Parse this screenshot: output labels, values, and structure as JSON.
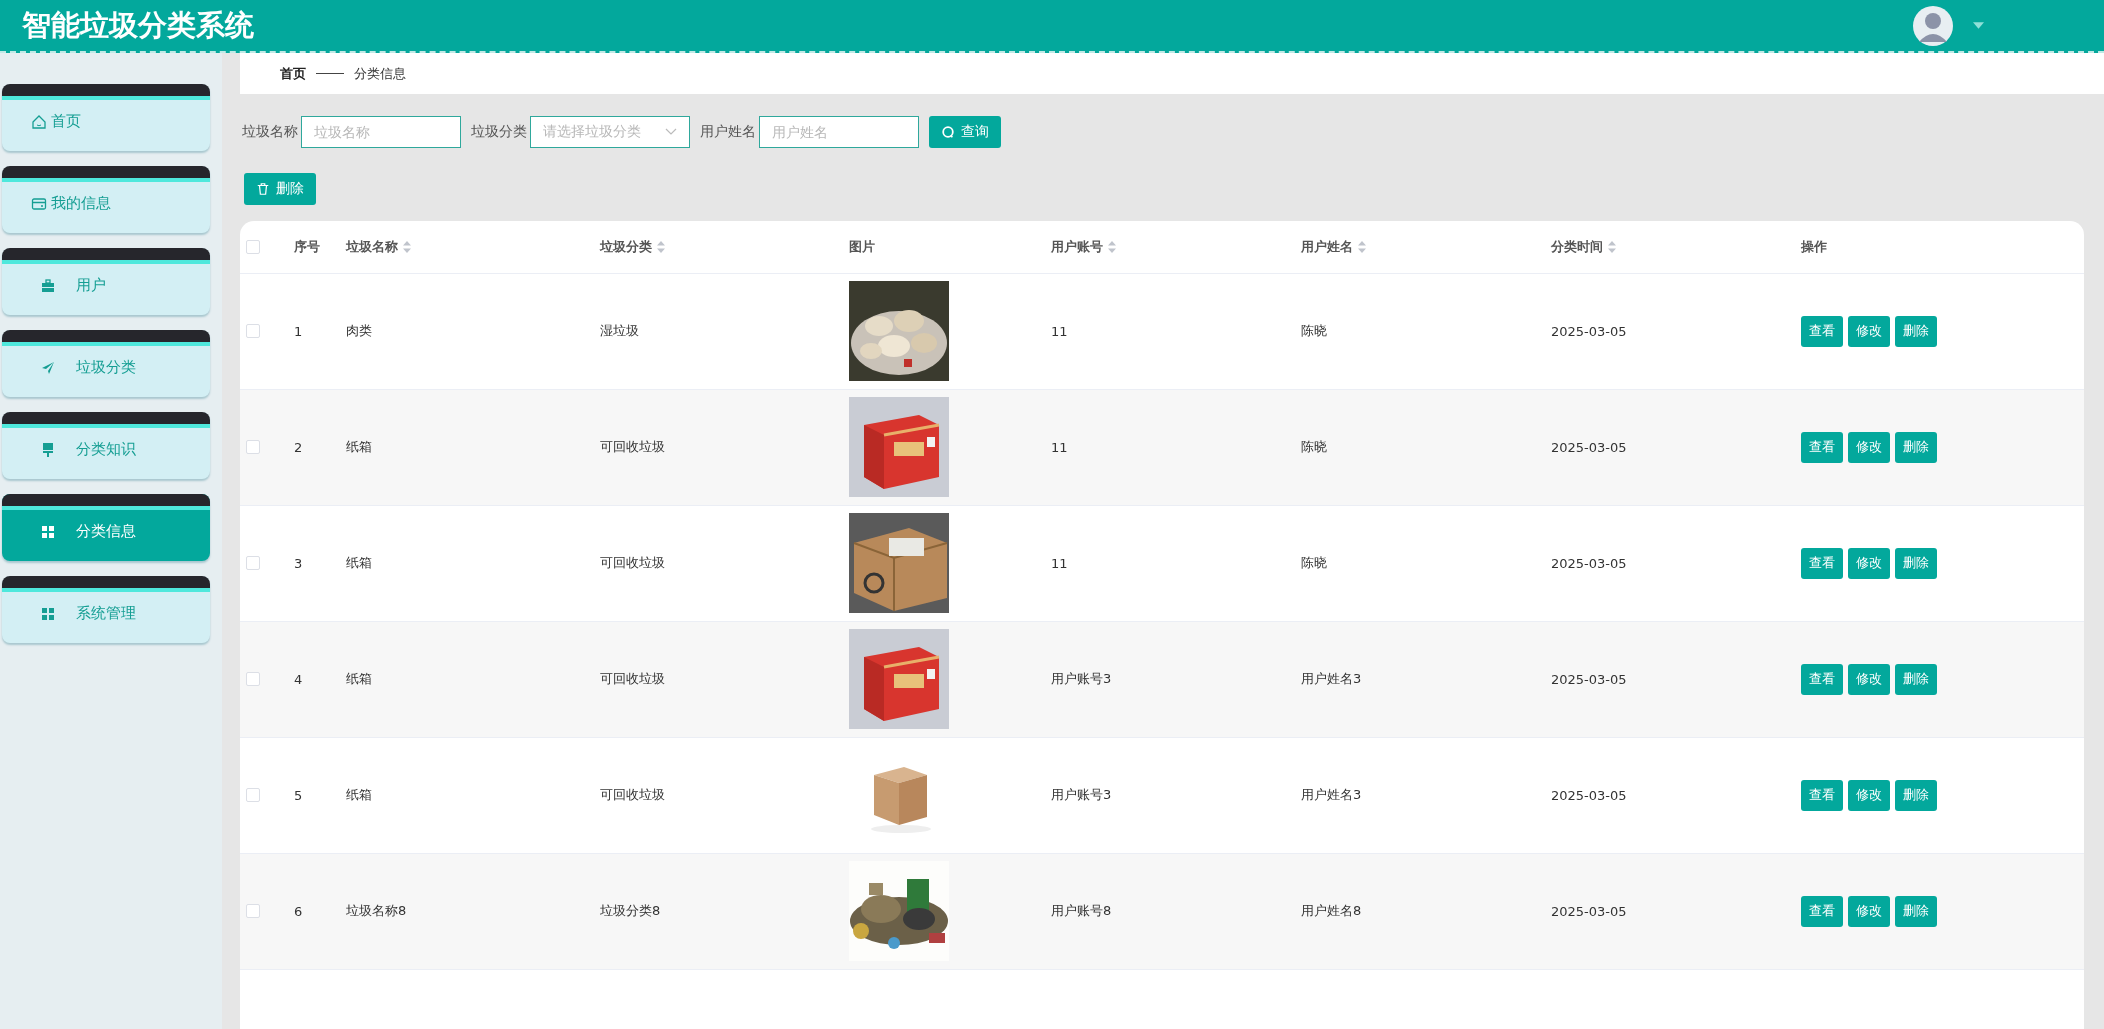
{
  "header": {
    "title": "智能垃圾分类系统"
  },
  "sidebar": {
    "items": [
      {
        "label": "首页",
        "selected": false
      },
      {
        "label": "我的信息",
        "selected": false
      },
      {
        "label": "用户",
        "selected": false
      },
      {
        "label": "垃圾分类",
        "selected": false
      },
      {
        "label": "分类知识",
        "selected": false
      },
      {
        "label": "分类信息",
        "selected": true
      },
      {
        "label": "系统管理",
        "selected": false
      }
    ]
  },
  "breadcrumb": [
    "首页",
    "分类信息"
  ],
  "search": {
    "fields": [
      {
        "label": "垃圾名称",
        "placeholder": "垃圾名称",
        "kind": "text"
      },
      {
        "label": "垃圾分类",
        "placeholder": "请选择垃圾分类",
        "kind": "select"
      },
      {
        "label": "用户姓名",
        "placeholder": "用户姓名",
        "kind": "text"
      }
    ],
    "button": "查询"
  },
  "delete_button": "删除",
  "table": {
    "all_checked": false,
    "columns": [
      {
        "label": "序号",
        "sortable": false
      },
      {
        "label": "垃圾名称",
        "sortable": true
      },
      {
        "label": "垃圾分类",
        "sortable": true
      },
      {
        "label": "图片",
        "sortable": false
      },
      {
        "label": "用户账号",
        "sortable": true
      },
      {
        "label": "用户姓名",
        "sortable": true
      },
      {
        "label": "分类时间",
        "sortable": true
      },
      {
        "label": "操作",
        "sortable": false
      }
    ],
    "rows": [
      {
        "checked": false,
        "cells": [
          "1",
          "肉类",
          "湿垃圾",
          "",
          "11",
          "陈晓",
          "2025-03-05"
        ],
        "actions": [
          "查看",
          "修改",
          "删除"
        ]
      },
      {
        "checked": false,
        "cells": [
          "2",
          "纸箱",
          "可回收垃圾",
          "",
          "11",
          "陈晓",
          "2025-03-05"
        ],
        "actions": [
          "查看",
          "修改",
          "删除"
        ]
      },
      {
        "checked": false,
        "cells": [
          "3",
          "纸箱",
          "可回收垃圾",
          "",
          "11",
          "陈晓",
          "2025-03-05"
        ],
        "actions": [
          "查看",
          "修改",
          "删除"
        ]
      },
      {
        "checked": false,
        "cells": [
          "4",
          "纸箱",
          "可回收垃圾",
          "",
          "用户账号3",
          "用户姓名3",
          "2025-03-05"
        ],
        "actions": [
          "查看",
          "修改",
          "删除"
        ]
      },
      {
        "checked": false,
        "cells": [
          "5",
          "纸箱",
          "可回收垃圾",
          "",
          "用户账号3",
          "用户姓名3",
          "2025-03-05"
        ],
        "actions": [
          "查看",
          "修改",
          "删除"
        ]
      },
      {
        "checked": false,
        "cells": [
          "6",
          "垃圾名称8",
          "垃圾分类8",
          "",
          "用户账号8",
          "用户姓名8",
          "2025-03-05"
        ],
        "actions": [
          "查看",
          "修改",
          "删除"
        ]
      }
    ]
  }
}
